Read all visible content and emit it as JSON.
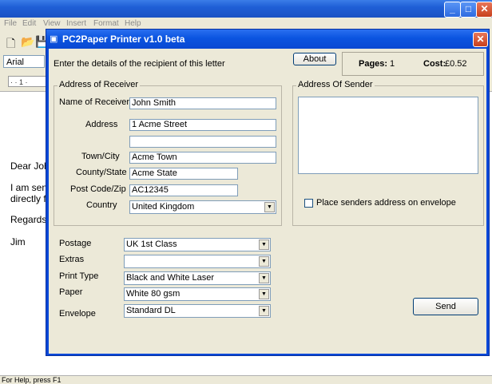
{
  "background_app": {
    "menu": [
      "File",
      "Edit",
      "View",
      "Insert",
      "Format",
      "Help"
    ],
    "font_name": "Arial",
    "ruler_text": "· · 1 ·",
    "letter_lines": [
      "Dear Joh",
      "I am sen",
      "directly f",
      "Regards,",
      "Jim"
    ],
    "status_text": "For Help, press F1"
  },
  "dialog": {
    "title": "PC2Paper Printer v1.0 beta",
    "instructions": "Enter the details of the recipient of this letter",
    "about_label": "About",
    "pages_label": "Pages:",
    "pages_value": "1",
    "cost_label": "Cost:",
    "cost_value": "£0.52",
    "receiver": {
      "legend": "Address of Receiver",
      "name_label": "Name of Receiver",
      "name_value": "John Smith",
      "address_label": "Address",
      "address_line1": "1 Acme Street",
      "address_line2": "",
      "town_label": "Town/City",
      "town_value": "Acme Town",
      "county_label": "County/State",
      "county_value": "Acme State",
      "postcode_label": "Post Code/Zip",
      "postcode_value": "AC12345",
      "country_label": "Country",
      "country_value": "United Kingdom"
    },
    "sender": {
      "legend": "Address Of Sender",
      "address_value": "",
      "envelope_checkbox_label": "Place senders address on envelope"
    },
    "options": {
      "postage_label": "Postage",
      "postage_value": "UK 1st Class",
      "extras_label": "Extras",
      "extras_value": "",
      "print_type_label": "Print Type",
      "print_type_value": "Black and White Laser",
      "paper_label": "Paper",
      "paper_value": "White 80 gsm",
      "envelope_label": "Envelope",
      "envelope_value": "Standard DL"
    },
    "send_label": "Send"
  }
}
